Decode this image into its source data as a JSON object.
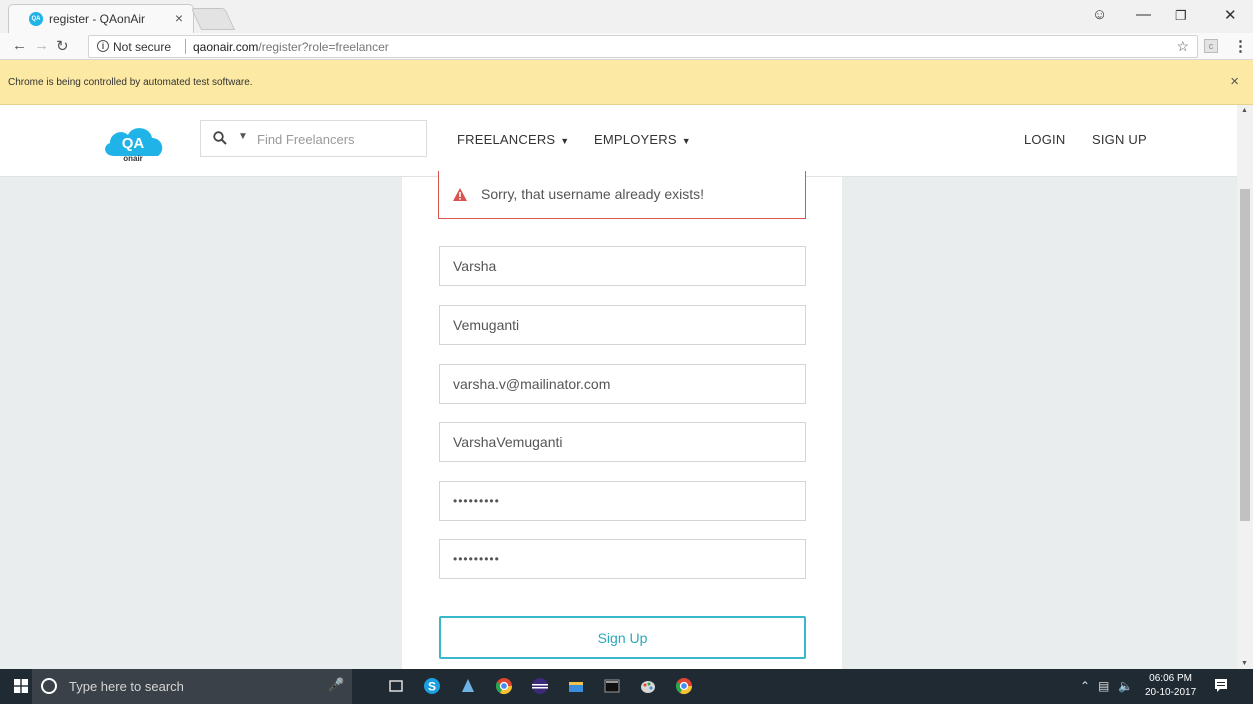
{
  "browser": {
    "tab_title": "register - QAonAir",
    "tab_favicon_text": "QA",
    "tab_close": "×",
    "not_secure": "Not secure",
    "url_host": "qaonair.com",
    "url_path": "/register?role=freelancer",
    "infobar_message": "Chrome is being controlled by automated test software.",
    "infobar_close": "×",
    "icons": [
      "back-icon",
      "forward-icon",
      "reload-icon",
      "info-icon",
      "star-icon",
      "menu-icon",
      "user-icon",
      "minimize-icon",
      "maximize-icon",
      "close-icon"
    ]
  },
  "header": {
    "logo_text_top": "QA",
    "logo_text_bottom": "onair",
    "search_placeholder": "Find Freelancers",
    "nav": {
      "freelancers": "FREELANCERS",
      "employers": "EMPLOYERS",
      "login": "LOGIN",
      "signup": "SIGN UP"
    }
  },
  "form": {
    "error_message": "Sorry, that username already exists!",
    "first_name": "Varsha",
    "last_name": "Vemuganti",
    "email": "varsha.v@mailinator.com",
    "username": "VarshaVemuganti",
    "password": "•••••••••",
    "confirm_password": "•••••••••",
    "submit_label": "Sign Up"
  },
  "taskbar": {
    "search_placeholder": "Type here to search",
    "time": "06:06 PM",
    "date": "20-10-2017",
    "app_icons": [
      "task-view-icon",
      "skype-icon",
      "app-icon",
      "chrome-icon",
      "eclipse-icon",
      "file-explorer-icon",
      "terminal-icon",
      "paint-icon",
      "chrome-icon"
    ]
  },
  "colors": {
    "accent": "#38b8c9",
    "error": "#d9534f",
    "infobar": "#fce9a4",
    "page_bg": "#e9edee",
    "taskbar": "#1f2a33"
  }
}
